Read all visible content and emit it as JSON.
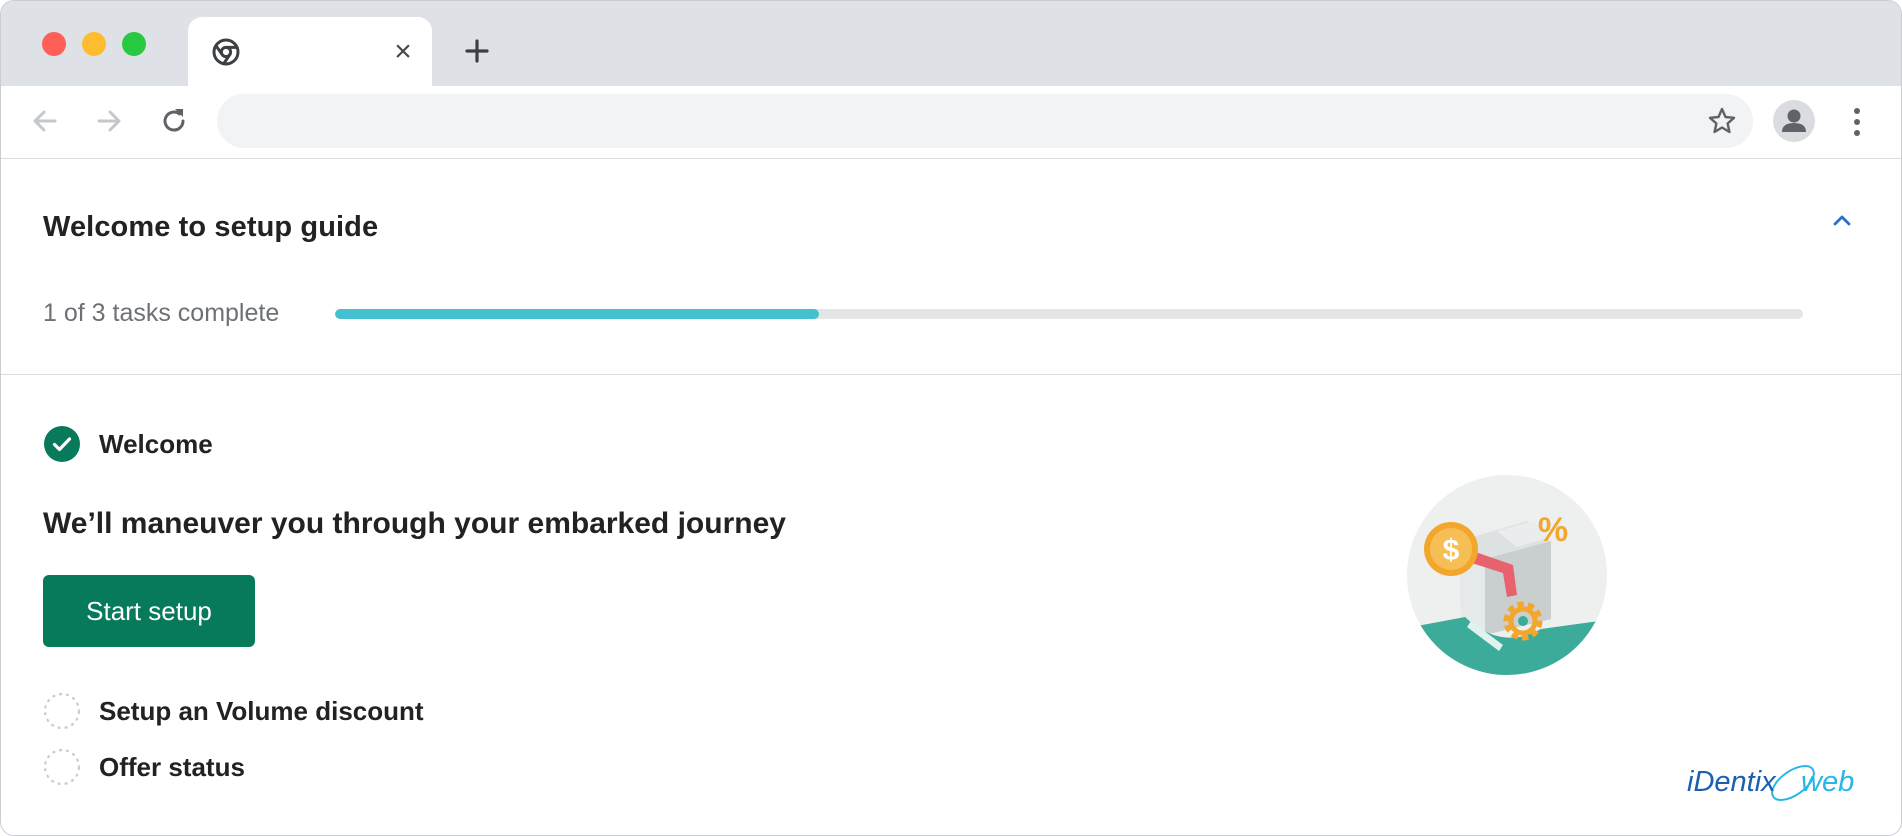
{
  "browser": {
    "tab": {
      "title": "",
      "favicon": "chrome-icon",
      "close_label": "×"
    },
    "new_tab_icon": "plus-icon",
    "toolbar": {
      "back_icon": "arrow-left-icon",
      "forward_icon": "arrow-right-icon",
      "reload_icon": "reload-icon",
      "address_value": "",
      "bookmark_icon": "star-icon",
      "profile_icon": "person-icon",
      "menu_icon": "kebab-icon"
    },
    "traffic_lights": {
      "red": "#fe5f57",
      "yellow": "#febc2e",
      "green": "#28c840"
    }
  },
  "setup_guide": {
    "title": "Welcome to setup guide",
    "collapse_icon": "chevron-up-icon",
    "progress": {
      "text": "1 of 3 tasks complete",
      "completed": 1,
      "total": 3,
      "fraction": 0.33,
      "fill_color": "#45c0d0",
      "track_color": "#e4e5e7"
    },
    "tasks": [
      {
        "label": "Welcome",
        "status": "complete",
        "icon": "check-circle-icon",
        "description": "We’ll maneuver you through your embarked journey",
        "button_label": "Start setup"
      },
      {
        "label": "Setup an Volume discount",
        "status": "incomplete",
        "icon": "dashed-circle-icon"
      },
      {
        "label": "Offer status",
        "status": "incomplete",
        "icon": "dashed-circle-icon"
      }
    ],
    "accent_color": "#087a5c",
    "illustration": "discount-illustration"
  },
  "watermark": {
    "text": "iDentixweb",
    "colors": {
      "primary": "#1b5fb0",
      "secondary": "#2ab5e8"
    }
  }
}
